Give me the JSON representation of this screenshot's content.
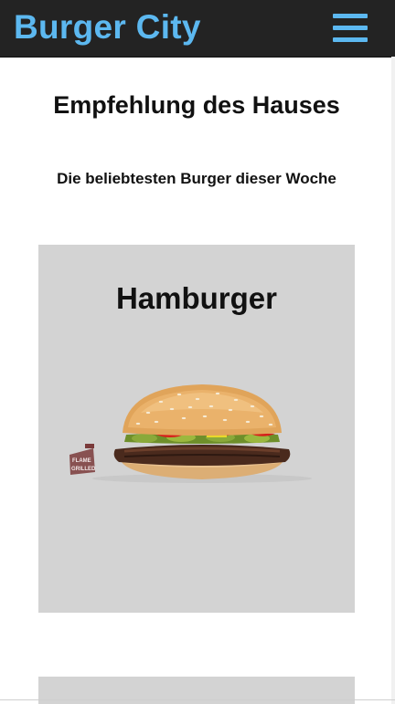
{
  "header": {
    "brand": "Burger City",
    "menu_icon": "hamburger-menu-icon"
  },
  "featured": {
    "title": "Empfehlung des Hauses",
    "subtitle": "Die beliebtesten Burger dieser Woche",
    "cards": [
      {
        "name": "Hamburger",
        "badge_text": "FLAME GRILLED",
        "image": "burger-image"
      }
    ]
  },
  "colors": {
    "header_bg": "#232323",
    "accent": "#5cb8f0",
    "card_bg": "#d3d3d3"
  }
}
